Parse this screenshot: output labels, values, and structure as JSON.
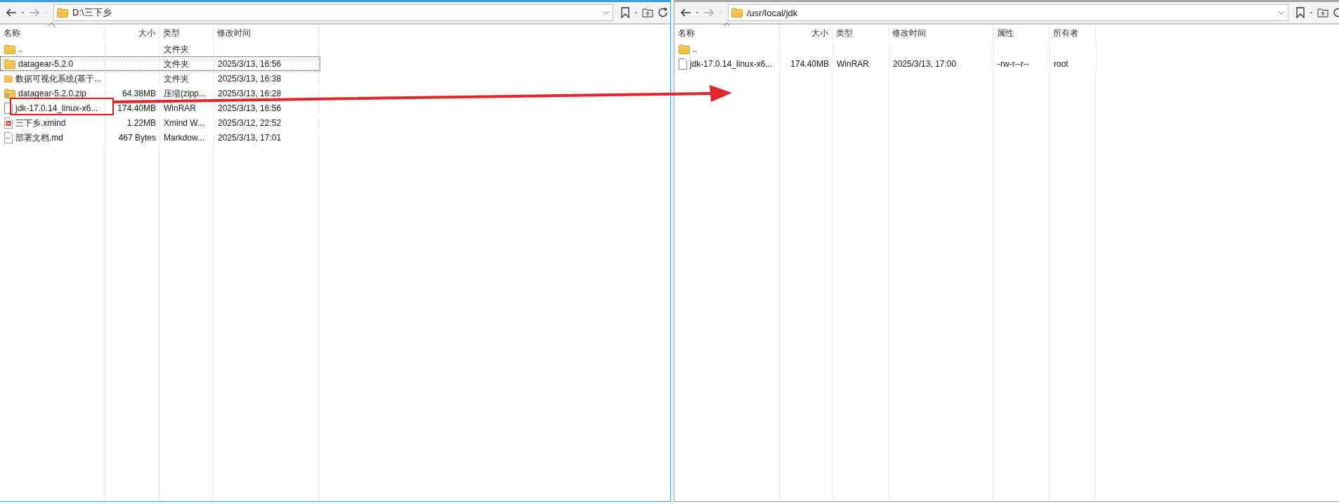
{
  "panes": [
    {
      "kind": "local",
      "active": true,
      "path": "D:\\三下乡",
      "columns": [
        {
          "label": "名称",
          "sorted": true
        },
        {
          "label": "大小",
          "sorted": false
        },
        {
          "label": "类型",
          "sorted": false
        },
        {
          "label": "修改时间",
          "sorted": false
        }
      ],
      "rows": [
        {
          "kind": "folder",
          "focused": false,
          "name": "..",
          "type": "文件夹"
        },
        {
          "kind": "folder",
          "focused": true,
          "name": "datagear-5.2.0",
          "type": "文件夹",
          "modified": "2025/3/13, 16:56"
        },
        {
          "kind": "folder",
          "focused": false,
          "name": "数据可视化系统(基于...",
          "type": "文件夹",
          "modified": "2025/3/13, 16:38"
        },
        {
          "kind": "zip",
          "focused": false,
          "name": "datagear-5.2.0.zip",
          "size": "64.38MB",
          "type": "压缩(zipp...",
          "modified": "2025/3/13, 16:28"
        },
        {
          "kind": "file",
          "focused": false,
          "name": "jdk-17.0.14_linux-x6...",
          "size": "174.40MB",
          "type": "WinRAR",
          "modified": "2025/3/13, 16:56"
        },
        {
          "kind": "xmind",
          "focused": false,
          "name": "三下乡.xmind",
          "size": "1.22MB",
          "type": "Xmind W...",
          "modified": "2025/3/12, 22:52"
        },
        {
          "kind": "markdown",
          "focused": false,
          "name": "部署文档.md",
          "size": "467 Bytes",
          "type": "Markdow...",
          "modified": "2025/3/13, 17:01"
        }
      ]
    },
    {
      "kind": "remote",
      "active": false,
      "path": "/usr/local/jdk",
      "columns": [
        {
          "label": "名称",
          "sorted": true
        },
        {
          "label": "大小",
          "sorted": false
        },
        {
          "label": "类型",
          "sorted": false
        },
        {
          "label": "修改时间",
          "sorted": false
        },
        {
          "label": "属性",
          "sorted": false
        },
        {
          "label": "所有者",
          "sorted": false
        }
      ],
      "rows": [
        {
          "kind": "folder",
          "focused": false,
          "name": ".."
        },
        {
          "kind": "file",
          "focused": false,
          "name": "jdk-17.0.14_linux-x6...",
          "size": "174.40MB",
          "type": "WinRAR",
          "modified": "2025/3/13, 17:00",
          "attributes": "-rw-r--r--",
          "owner": "root"
        }
      ]
    }
  ]
}
